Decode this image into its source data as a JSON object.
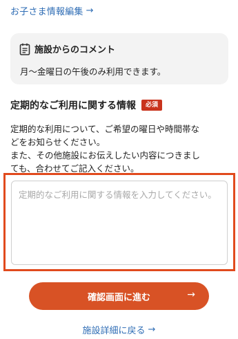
{
  "links": {
    "edit_child": "お子さま情報編集",
    "back_detail": "施設詳細に戻る",
    "arrow": "→"
  },
  "comment": {
    "title": "施設からのコメント",
    "body": "月〜金曜日の午後のみ利用できます。",
    "icon": "clipboard-icon"
  },
  "section": {
    "title": "定期的なご利用に関する情報",
    "required_badge": "必須",
    "description": [
      "定期的な利用について、ご希望の曜日や時間帯な",
      "どをお知らせください。",
      "また、その他施設にお伝えしたい内容につきまし",
      "ても、合わせてご記入ください。"
    ]
  },
  "form": {
    "input_value": "",
    "placeholder": "定期的なご利用に関する情報を入力してください。"
  },
  "buttons": {
    "confirm": "確認画面に進む",
    "confirm_arrow": "→"
  },
  "colors": {
    "link": "#2f6db5",
    "accent": "#d85225",
    "badge": "#c9331d",
    "highlight_border": "#e14a1d",
    "card_bg": "#f3f3f3"
  }
}
